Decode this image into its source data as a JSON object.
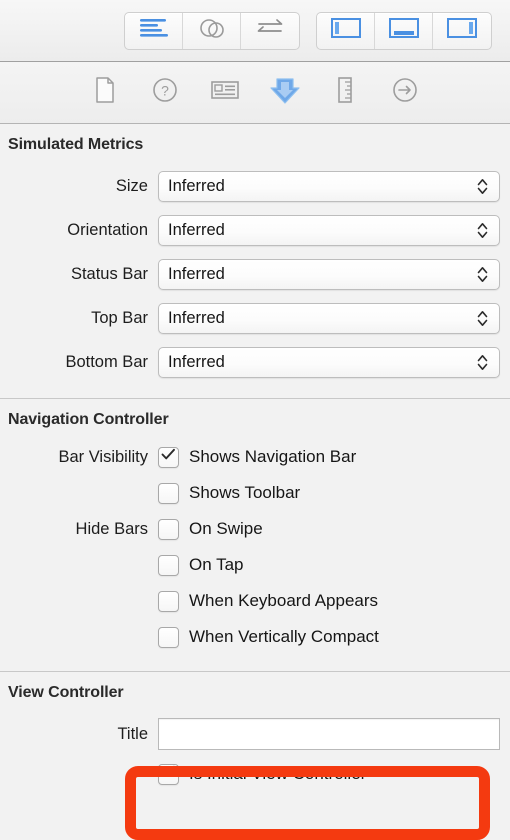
{
  "toolbar": {
    "editor_group": [
      {
        "name": "align-editor-button",
        "icon": "align-lines-icon",
        "state": "active"
      },
      {
        "name": "assistant-editor-button",
        "icon": "overlapping-circles-icon",
        "state": "normal"
      },
      {
        "name": "version-editor-button",
        "icon": "swap-arrows-icon",
        "state": "normal"
      }
    ],
    "panel_group": [
      {
        "name": "toggle-navigator-button",
        "icon": "left-panel-icon",
        "state": "active"
      },
      {
        "name": "toggle-debug-area-button",
        "icon": "bottom-panel-icon",
        "state": "active"
      },
      {
        "name": "toggle-utilities-button",
        "icon": "right-panel-icon",
        "state": "active"
      }
    ]
  },
  "inspector_tabs": [
    {
      "name": "tab-file-inspector",
      "icon": "document-icon",
      "selected": false
    },
    {
      "name": "tab-quick-help",
      "icon": "question-circle-icon",
      "selected": false
    },
    {
      "name": "tab-identity-inspector",
      "icon": "id-card-icon",
      "selected": false
    },
    {
      "name": "tab-attributes-inspector",
      "icon": "down-arrow-icon",
      "selected": true
    },
    {
      "name": "tab-size-inspector",
      "icon": "ruler-icon",
      "selected": false
    },
    {
      "name": "tab-connections-inspector",
      "icon": "arrow-circle-icon",
      "selected": false
    }
  ],
  "sections": {
    "simulated_metrics": {
      "title": "Simulated Metrics",
      "rows": [
        {
          "label": "Size",
          "value": "Inferred"
        },
        {
          "label": "Orientation",
          "value": "Inferred"
        },
        {
          "label": "Status Bar",
          "value": "Inferred"
        },
        {
          "label": "Top Bar",
          "value": "Inferred"
        },
        {
          "label": "Bottom Bar",
          "value": "Inferred"
        }
      ]
    },
    "navigation_controller": {
      "title": "Navigation Controller",
      "bar_visibility_label": "Bar Visibility",
      "hide_bars_label": "Hide Bars",
      "bar_visibility": [
        {
          "label": "Shows Navigation Bar",
          "checked": true
        },
        {
          "label": "Shows Toolbar",
          "checked": false
        }
      ],
      "hide_bars": [
        {
          "label": "On Swipe",
          "checked": false
        },
        {
          "label": "On Tap",
          "checked": false
        },
        {
          "label": "When Keyboard Appears",
          "checked": false
        },
        {
          "label": "When Vertically Compact",
          "checked": false
        }
      ]
    },
    "view_controller": {
      "title": "View Controller",
      "title_label": "Title",
      "title_value": "",
      "title_placeholder": "",
      "is_initial": {
        "label": "Is Initial View Controller",
        "checked": true
      }
    }
  },
  "annotation": {
    "name": "red-highlight-box",
    "color": "#f43a10",
    "targets": "is-initial-view-controller-checkbox"
  },
  "colors": {
    "accent_blue": "#54a0e8",
    "background": "#f2f2f2",
    "divider": "#c8c8c8",
    "annotation_red": "#f43a10"
  }
}
